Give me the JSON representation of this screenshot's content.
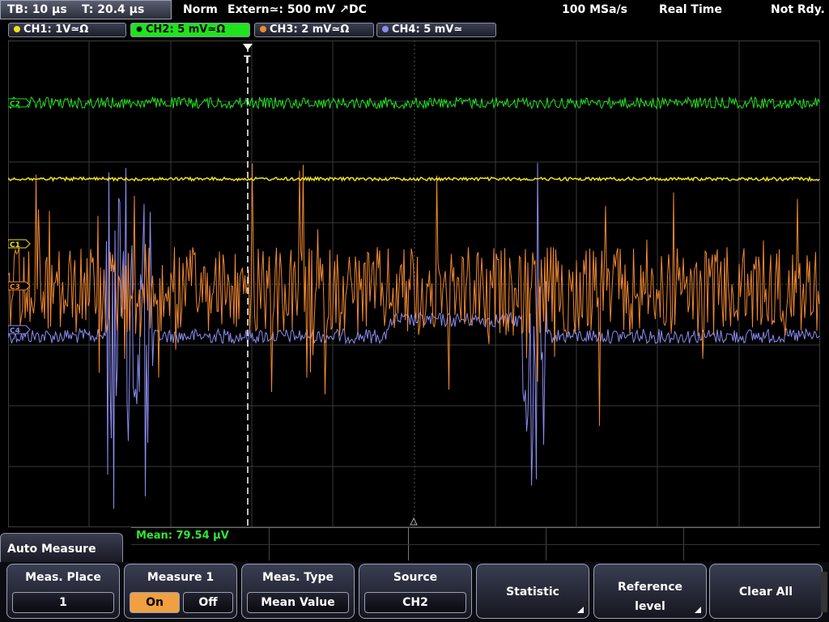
{
  "topbar": {
    "timebase": "TB: 10 µs",
    "trigger_time": "T: 20.4 µs",
    "mode": "Norm",
    "trigger_source": "Extern≃: 500 mV ↗DC",
    "sample_rate": "100 MSa/s",
    "acq_mode": "Real Time",
    "state": "Not Rdy."
  },
  "channels": [
    {
      "label": "CH1: 1V≃Ω",
      "color": "#f0e020"
    },
    {
      "label": "CH2: 5 mV≃Ω",
      "color": "#21e21e"
    },
    {
      "label": "CH3: 2 mV≃Ω",
      "color": "#f08830"
    },
    {
      "label": "CH4: 5 mV≃",
      "color": "#8c8cf0"
    }
  ],
  "markers": {
    "c2": "C2",
    "c1": "C1",
    "c3": "C3",
    "c4": "C4",
    "trigger": "T"
  },
  "measurement": {
    "result": "Mean: 79.54 µV"
  },
  "menu": {
    "title": "Auto Measure",
    "meas_place": {
      "label": "Meas. Place",
      "value": "1"
    },
    "measure1": {
      "label": "Measure 1",
      "on": "On",
      "off": "Off"
    },
    "meas_type": {
      "label": "Meas. Type",
      "value": "Mean Value"
    },
    "source": {
      "label": "Source",
      "value": "CH2"
    },
    "statistic": {
      "label": "Statistic"
    },
    "reference": {
      "label_line1": "Reference",
      "label_line2": "level"
    },
    "clear": {
      "label": "Clear All"
    }
  }
}
